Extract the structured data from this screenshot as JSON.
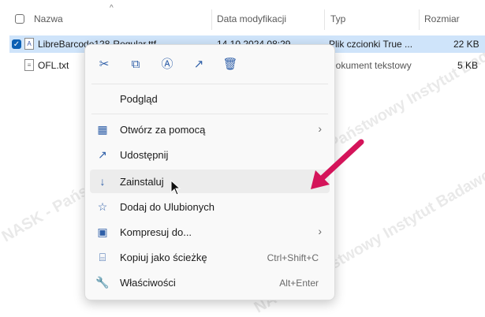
{
  "header": {
    "name": "Nazwa",
    "date": "Data modyfikacji",
    "type": "Typ",
    "size": "Rozmiar"
  },
  "files": [
    {
      "name": "LibreBarcode128-Regular.ttf",
      "date": "14.10.2024 08:29",
      "type": "Plik czcionki True ...",
      "size": "22 KB",
      "selected": true,
      "icon": "font-file-icon"
    },
    {
      "name": "OFL.txt",
      "date": "",
      "type": "Dokument tekstowy",
      "size": "5 KB",
      "selected": false,
      "icon": "text-file-icon"
    }
  ],
  "toolbar": [
    {
      "name": "cut-icon",
      "glyph": "✂"
    },
    {
      "name": "copy-icon",
      "glyph": "⧉"
    },
    {
      "name": "rename-icon",
      "glyph": "Ⓐ"
    },
    {
      "name": "share-icon",
      "glyph": "↗"
    },
    {
      "name": "delete-icon",
      "glyph": "🗑"
    }
  ],
  "menu": {
    "preview": "Podgląd",
    "items": [
      {
        "label": "Otwórz za pomocą",
        "shortcut": "",
        "submenu": true,
        "icon": "open-with-icon",
        "glyph": "▦"
      },
      {
        "label": "Udostępnij",
        "shortcut": "",
        "submenu": false,
        "icon": "share-icon",
        "glyph": "↗"
      },
      {
        "label": "Zainstaluj",
        "shortcut": "",
        "submenu": false,
        "icon": "install-icon",
        "glyph": "↓"
      },
      {
        "label": "Dodaj do Ulubionych",
        "shortcut": "",
        "submenu": false,
        "icon": "star-icon",
        "glyph": "☆"
      },
      {
        "label": "Kompresuj do...",
        "shortcut": "",
        "submenu": true,
        "icon": "compress-icon",
        "glyph": "▣"
      },
      {
        "label": "Kopiuj jako ścieżkę",
        "shortcut": "Ctrl+Shift+C",
        "submenu": false,
        "icon": "copy-path-icon",
        "glyph": "⌸"
      },
      {
        "label": "Właściwości",
        "shortcut": "Alt+Enter",
        "submenu": false,
        "icon": "properties-icon",
        "glyph": "🔧"
      }
    ]
  },
  "watermark": "NASK - Państwowy Instytut Badawczy",
  "colors": {
    "accent": "#0a5fb4",
    "selection": "#cfe4fa",
    "arrow": "#d4145a"
  }
}
